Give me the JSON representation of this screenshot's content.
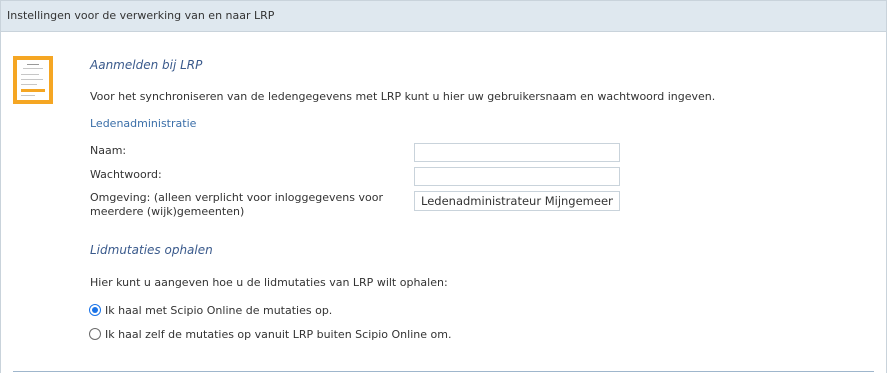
{
  "header": {
    "title": "Instellingen voor de verwerking van en naar LRP"
  },
  "login": {
    "title": "Aanmelden bij LRP",
    "description": "Voor het synchroniseren van de ledengegevens met LRP kunt u hier uw gebruikersnaam en wachtwoord ingeven.",
    "subheading": "Ledenadministratie",
    "name_label": "Naam:",
    "name_value": "",
    "password_label": "Wachtwoord:",
    "password_value": "",
    "environment_label": "Omgeving: (alleen verplicht voor inloggegevens voor meerdere (wijk)gemeenten)",
    "environment_value": "Ledenadministrateur Mijngemeente"
  },
  "mutations": {
    "title": "Lidmutaties ophalen",
    "description": "Hier kunt u aangeven hoe u de lidmutaties van LRP wilt ophalen:",
    "options": [
      {
        "label": "Ik haal met Scipio Online de mutaties op.",
        "checked": true
      },
      {
        "label": "Ik haal zelf de mutaties op vanuit LRP buiten Scipio Online om.",
        "checked": false
      }
    ]
  },
  "colors": {
    "header_bg": "#dfe8ef",
    "accent_orange": "#f5a623",
    "section_title": "#3a5a8c",
    "radio_selected": "#1a73e8"
  },
  "icons": {
    "document": "document-form-icon"
  }
}
